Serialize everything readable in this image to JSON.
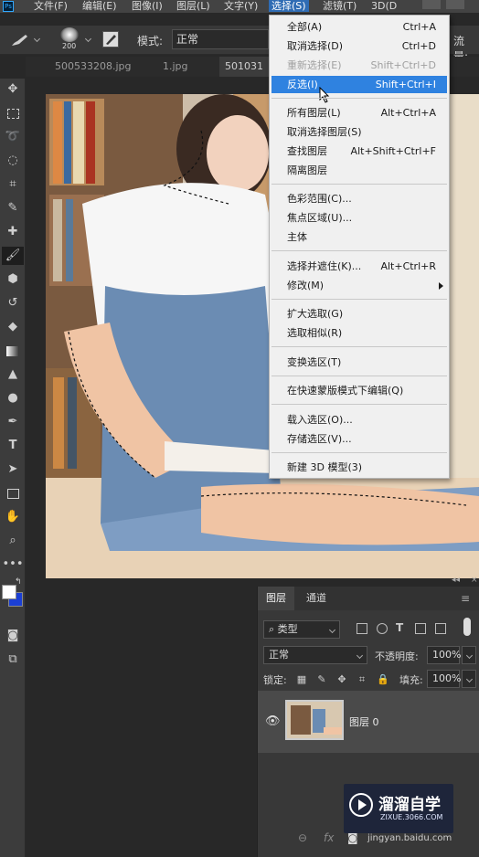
{
  "menubar": {
    "items": [
      {
        "label": "文件(F)"
      },
      {
        "label": "编辑(E)"
      },
      {
        "label": "图像(I)"
      },
      {
        "label": "图层(L)"
      },
      {
        "label": "文字(Y)"
      },
      {
        "label": "选择(S)"
      },
      {
        "label": "滤镜(T)"
      },
      {
        "label": "3D(D"
      }
    ]
  },
  "options_bar": {
    "brush_size": "200",
    "mode_label": "模式:",
    "mode_value": "正常",
    "flow_label": "流量:"
  },
  "tabs": [
    {
      "label": "500533208.jpg"
    },
    {
      "label": "1.jpg"
    },
    {
      "label": "501031"
    }
  ],
  "select_menu": {
    "items": [
      {
        "label": "全部(A)",
        "shortcut": "Ctrl+A"
      },
      {
        "label": "取消选择(D)",
        "shortcut": "Ctrl+D"
      },
      {
        "label": "重新选择(E)",
        "shortcut": "Shift+Ctrl+D"
      },
      {
        "label": "反选(I)",
        "shortcut": "Shift+Ctrl+I"
      },
      {
        "label": "所有图层(L)",
        "shortcut": "Alt+Ctrl+A"
      },
      {
        "label": "取消选择图层(S)",
        "shortcut": ""
      },
      {
        "label": "查找图层",
        "shortcut": "Alt+Shift+Ctrl+F"
      },
      {
        "label": "隔离图层",
        "shortcut": ""
      },
      {
        "label": "色彩范围(C)...",
        "shortcut": ""
      },
      {
        "label": "焦点区域(U)...",
        "shortcut": ""
      },
      {
        "label": "主体",
        "shortcut": ""
      },
      {
        "label": "选择并遮住(K)...",
        "shortcut": "Alt+Ctrl+R"
      },
      {
        "label": "修改(M)",
        "shortcut": ""
      },
      {
        "label": "扩大选取(G)",
        "shortcut": ""
      },
      {
        "label": "选取相似(R)",
        "shortcut": ""
      },
      {
        "label": "变换选区(T)",
        "shortcut": ""
      },
      {
        "label": "在快速蒙版模式下编辑(Q)",
        "shortcut": ""
      },
      {
        "label": "载入选区(O)...",
        "shortcut": ""
      },
      {
        "label": "存储选区(V)...",
        "shortcut": ""
      },
      {
        "label": "新建 3D 模型(3)",
        "shortcut": ""
      }
    ]
  },
  "layers_panel": {
    "tab_layers": "图层",
    "tab_channels": "通道",
    "filter_kind": "类型",
    "blend_mode": "正常",
    "opacity_label": "不透明度:",
    "opacity_value": "100%",
    "lock_label": "锁定:",
    "fill_label": "填充:",
    "fill_value": "100%",
    "layer_name": "图层 0"
  },
  "watermark": {
    "brand": "溜溜自学",
    "url": "ZIXUE.3066.COM",
    "overlay_text": "jingyan.baidu.com"
  },
  "colors": {
    "accent": "#2f82e0",
    "foreground_swatch": "#ffffff",
    "background_swatch": "#1b3fd4"
  }
}
